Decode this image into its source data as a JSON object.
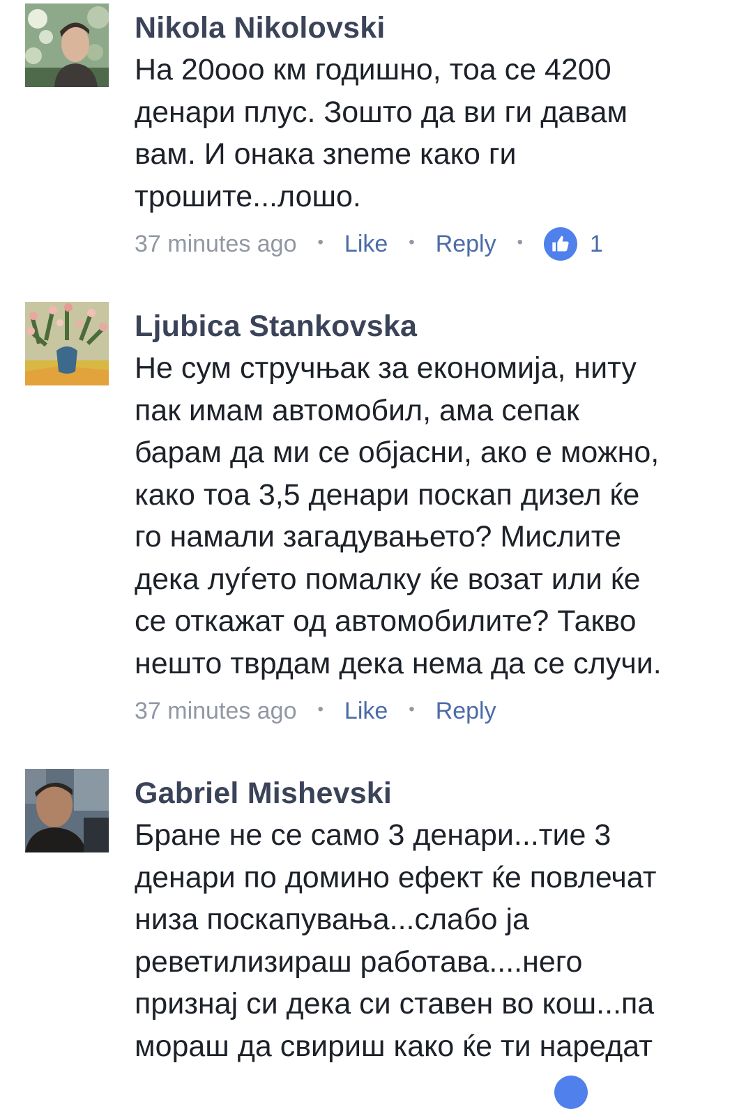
{
  "comments": [
    {
      "author": "Nikola Nikolovski",
      "text": "На 20ооо км годишно, тоа се 4200\nденари плус. Зошто да ви ги давам\nвам. И онака зneme како ги\nтрошите...лошо.",
      "time": "37 minutes ago",
      "like_label": "Like",
      "reply_label": "Reply",
      "reaction_count": "1"
    },
    {
      "author": "Ljubica Stankovska",
      "text": "Не сум стручњак за економија, ниту\nпак имам автомобил, ама сепак\nбарам да ми се објасни, ако е можно,\nкако тоа 3,5 денари поскап дизел ќе\nго намали загадувањето? Мислите\nдека луѓето помалку ќе возат или ќе\nсе откажат од автомобилите? Такво\nнешто тврдам дека нема да се случи.",
      "time": "37 minutes ago",
      "like_label": "Like",
      "reply_label": "Reply"
    },
    {
      "author": "Gabriel Mishevski",
      "text": "Бране не се само 3 денари...тие 3\nденари по домино ефект ќе повлечат\nниза поскапувања...слабо ја\nреветилизираш работава....него\nпризнај си дека си ставен во кош...па\nмораш да свириш како ќе ти наредат"
    }
  ],
  "icons": {
    "like_reaction": "thumbs-up-icon",
    "reaction_color": "#4f80ec"
  }
}
